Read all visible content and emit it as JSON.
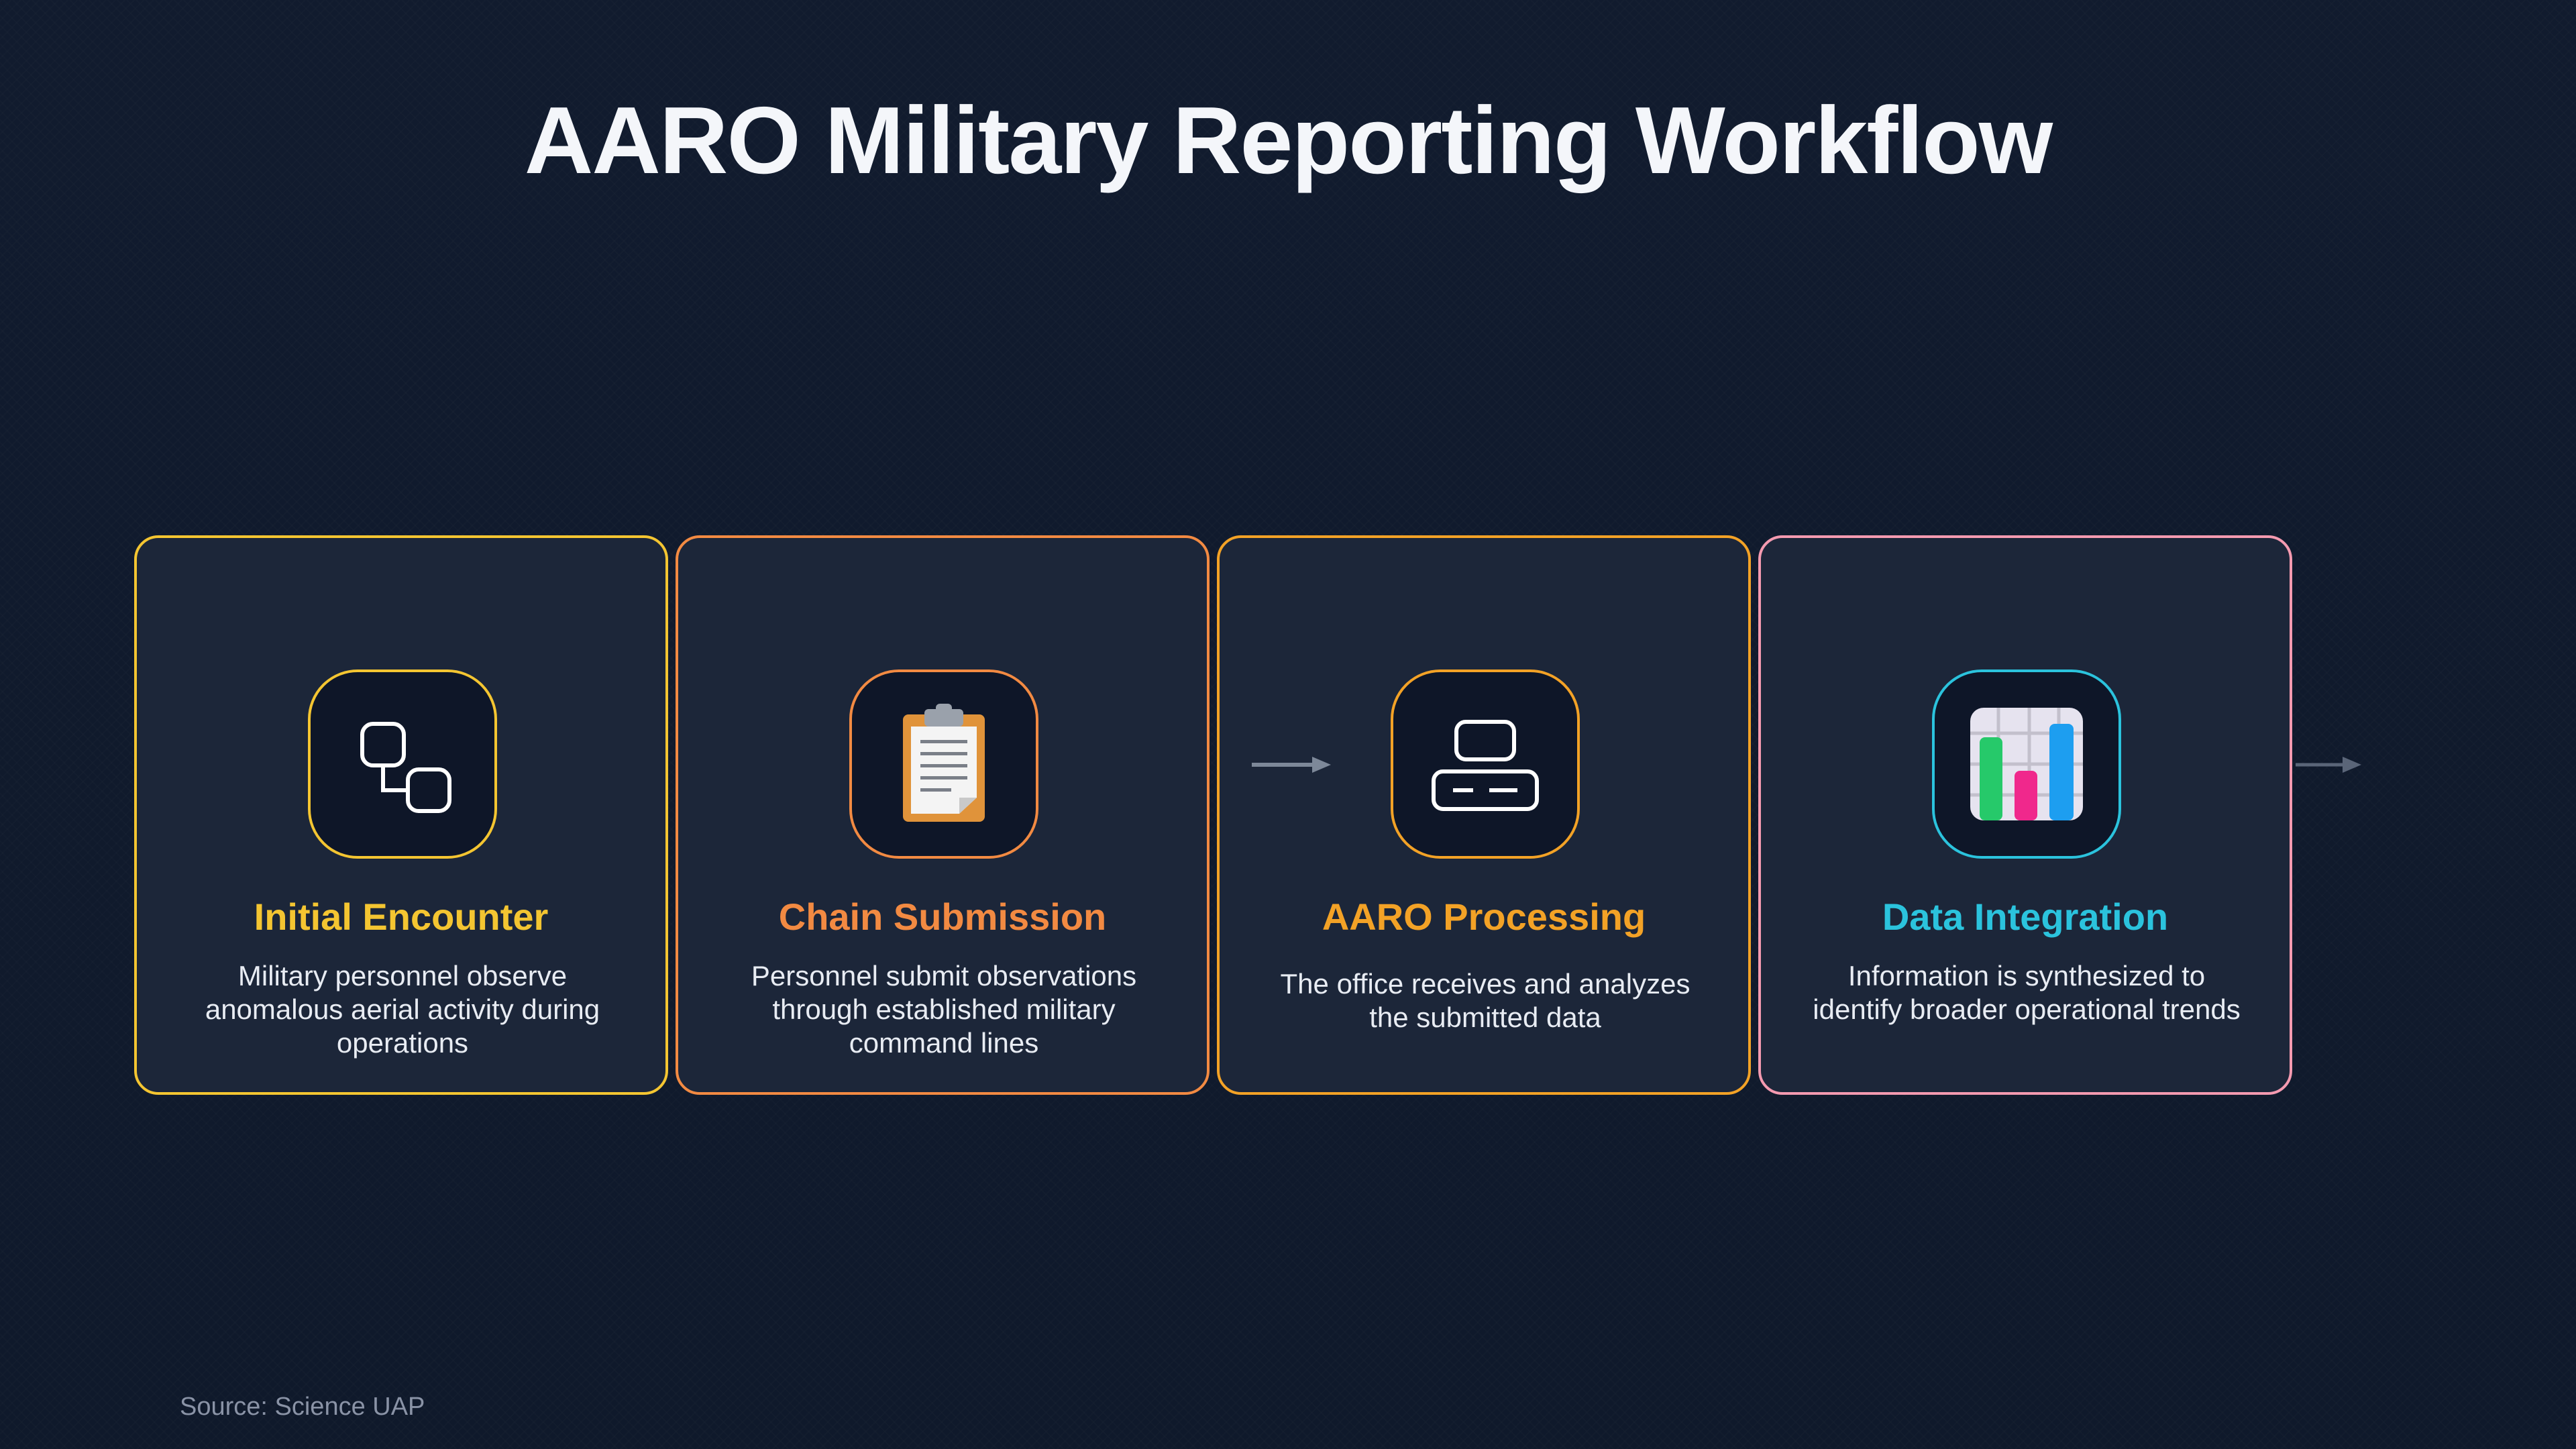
{
  "title": "AARO Military Reporting Workflow",
  "source": "Source: Science UAP",
  "steps": [
    {
      "title": "Initial Encounter",
      "description": "Military personnel observe anomalous aerial activity during operations",
      "accent": "#f4c531",
      "icon": "flow-nodes-icon"
    },
    {
      "title": "Chain Submission",
      "description": "Personnel submit observations through established military command lines",
      "accent": "#f28a42",
      "icon": "clipboard-icon"
    },
    {
      "title": "AARO Processing",
      "description": "The office receives and analyzes the submitted data",
      "accent": "#f3a226",
      "icon": "processing-box-icon"
    },
    {
      "title": "Data Integration",
      "description": "Information is synthesized to identify broader operational trends",
      "accent": "#2bc3dd",
      "border": "#f49ab0",
      "icon": "bar-chart-icon"
    }
  ]
}
